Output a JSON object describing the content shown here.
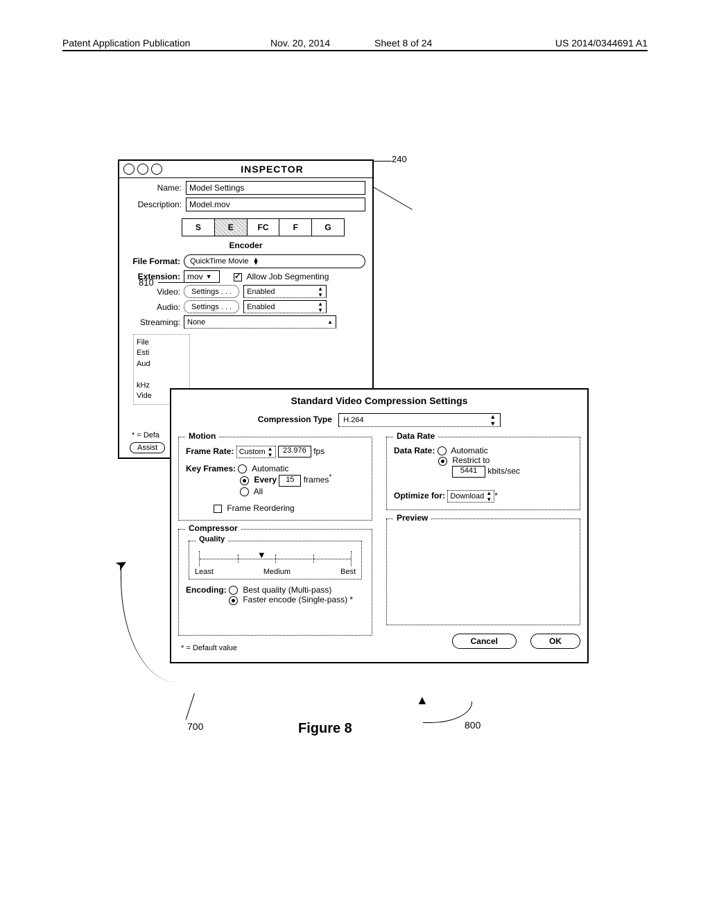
{
  "header": {
    "pubtype": "Patent Application Publication",
    "date": "Nov. 20, 2014",
    "sheet": "Sheet 8 of 24",
    "pubno": "US 2014/0344691 A1"
  },
  "callouts": {
    "c240": "240",
    "c810": "810",
    "c700": "700",
    "c800": "800"
  },
  "figure_label": "Figure 8",
  "inspector": {
    "title": "INSPECTOR",
    "name_label": "Name:",
    "name_value": "Model Settings",
    "desc_label": "Description:",
    "desc_value": "Model.mov",
    "tabs": [
      "S",
      "E",
      "FC",
      "F",
      "G"
    ],
    "selected_tab": "E",
    "encoder_title": "Encoder",
    "file_format_label": "File Format:",
    "file_format_value": "QuickTime Movie",
    "ext_label": "Extension:",
    "ext_value": "mov",
    "allow_seg": "Allow Job Segmenting",
    "video_label": "Video:",
    "audio_label": "Audio:",
    "settings_btn": "Settings . . .",
    "enabled_value": "Enabled",
    "streaming_label": "Streaming:",
    "streaming_value": "None",
    "summary_lines": [
      "File",
      "Esti",
      "Aud",
      "",
      "kHz",
      "Vide"
    ],
    "footnote": "* = Defa",
    "assist": "Assist"
  },
  "svcs": {
    "title": "Standard Video Compression Settings",
    "comp_type_label": "Compression Type",
    "comp_type_value": "H.264",
    "motion": {
      "legend": "Motion",
      "frame_rate_label": "Frame Rate:",
      "frame_rate_mode": "Custom",
      "frame_rate_value": "23.976",
      "fps": "fps",
      "key_frames_label": "Key Frames:",
      "auto": "Automatic",
      "every": "Every",
      "every_value": "15",
      "frames": "frames",
      "star": "*",
      "all": "All",
      "reorder": "Frame Reordering"
    },
    "datarate": {
      "legend": "Data Rate",
      "label": "Data Rate:",
      "auto": "Automatic",
      "restrict": "Restrict to",
      "value": "5441",
      "unit": "kbits/sec",
      "optimize_label": "Optimize for:",
      "optimize_value": "Download",
      "star": "*"
    },
    "compressor": {
      "legend": "Compressor",
      "quality_legend": "Quality",
      "least": "Least",
      "medium": "Medium",
      "best": "Best",
      "encoding_label": "Encoding:",
      "best_quality": "Best quality (Multi-pass)",
      "faster": "Faster encode (Single-pass) *"
    },
    "preview_legend": "Preview",
    "footnote": "* = Default value",
    "cancel": "Cancel",
    "ok": "OK"
  }
}
